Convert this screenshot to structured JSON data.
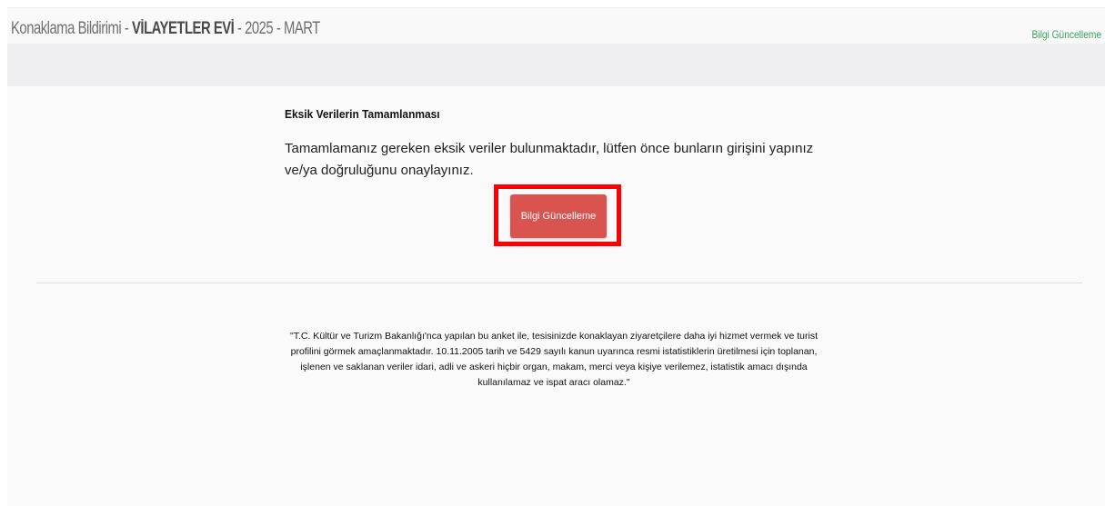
{
  "header": {
    "title_prefix": "Konaklama Bildirimi - ",
    "facility_name": "VİLAYETLER EVİ",
    "title_suffix": " - 2025 - MART",
    "link_label": "Bilgi Güncelleme"
  },
  "main": {
    "heading": "Eksik Verilerin Tamamlanması",
    "message": "Tamamlamanız gereken eksik veriler bulunmaktadır, lütfen önce bunların girişini yapınız ve/ya doğruluğunu onaylayınız.",
    "button_label": "Bilgi Güncelleme"
  },
  "footer": {
    "disclaimer": "\"T.C. Kültür ve Turizm Bakanlığı'nca yapılan bu anket ile, tesisinizde konaklayan ziyaretçilere daha iyi hizmet vermek ve turist profilini görmek amaçlanmaktadır. 10.11.2005 tarih ve 5429 sayılı kanun uyarınca resmi istatistiklerin üretilmesi için toplanan, işlenen ve saklanan veriler idari, adli ve askeri hiçbir organ, makam, merci veya kişiye verilemez, istatistik amacı dışında kullanılamaz ve ispat aracı olamaz.\""
  },
  "colors": {
    "button_bg": "#d9534f",
    "highlight_border": "#ff0000",
    "link": "#3aa05a"
  }
}
